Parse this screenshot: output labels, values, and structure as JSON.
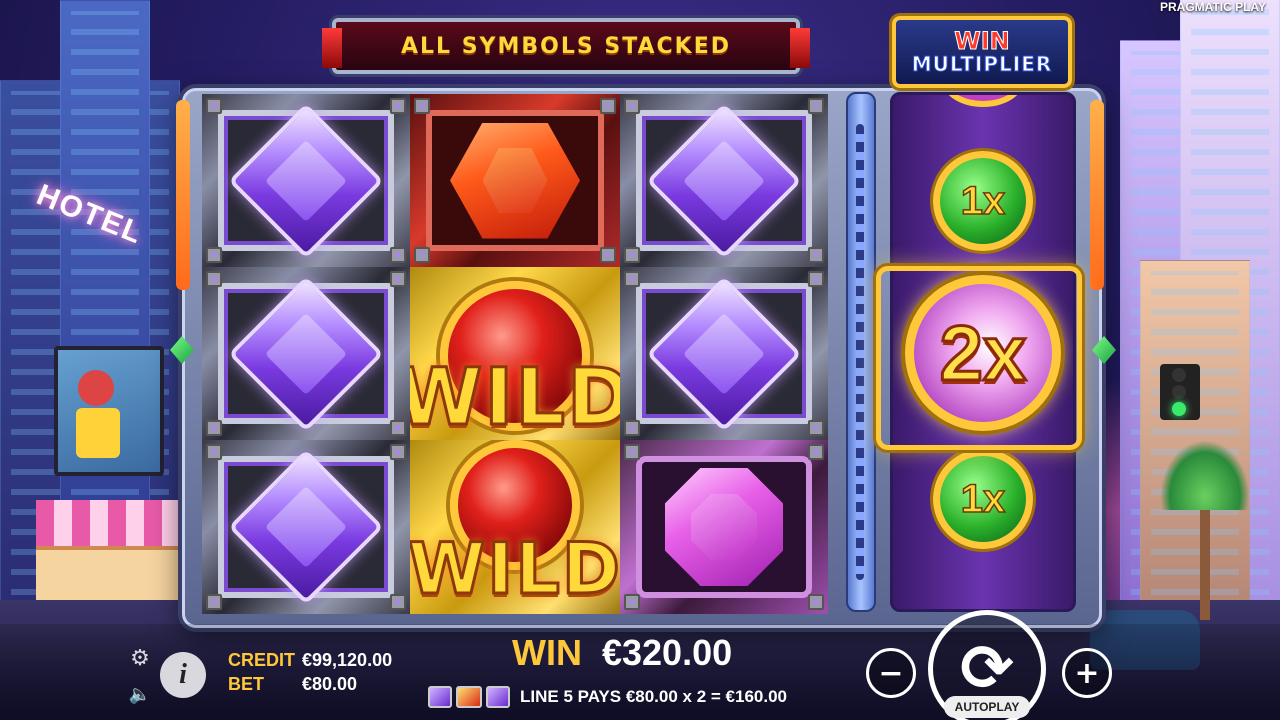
{
  "brand": "PRAGMATIC PLAY",
  "scenery": {
    "hotel_sign": "HOTEL"
  },
  "banners": {
    "feature": "ALL SYMBOLS STACKED",
    "win_multiplier_line1": "WIN",
    "win_multiplier_line2": "MULTIPLIER"
  },
  "reels": {
    "columns": [
      [
        "purple-gem",
        "purple-gem",
        "purple-gem"
      ],
      [
        "red-gem",
        "wild",
        "wild"
      ],
      [
        "purple-gem",
        "purple-gem",
        "magenta-gem"
      ]
    ],
    "wild_label": "WILD"
  },
  "multiplier_reel": {
    "top": "1x",
    "center": "2x",
    "bottom": "1x"
  },
  "hud": {
    "credit_label": "CREDIT",
    "credit_value": "€99,120.00",
    "bet_label": "BET",
    "bet_value": "€80.00",
    "win_label": "WIN",
    "win_value": "€320.00",
    "payline_text": "LINE 5 PAYS €80.00 x 2 = €160.00",
    "autoplay_label": "AUTOPLAY",
    "minus_label": "−",
    "plus_label": "+",
    "info_label": "i"
  },
  "icons": {
    "settings": "gear-icon",
    "sound": "speaker-icon",
    "info": "info-icon",
    "spin": "spin-arrows-icon"
  }
}
